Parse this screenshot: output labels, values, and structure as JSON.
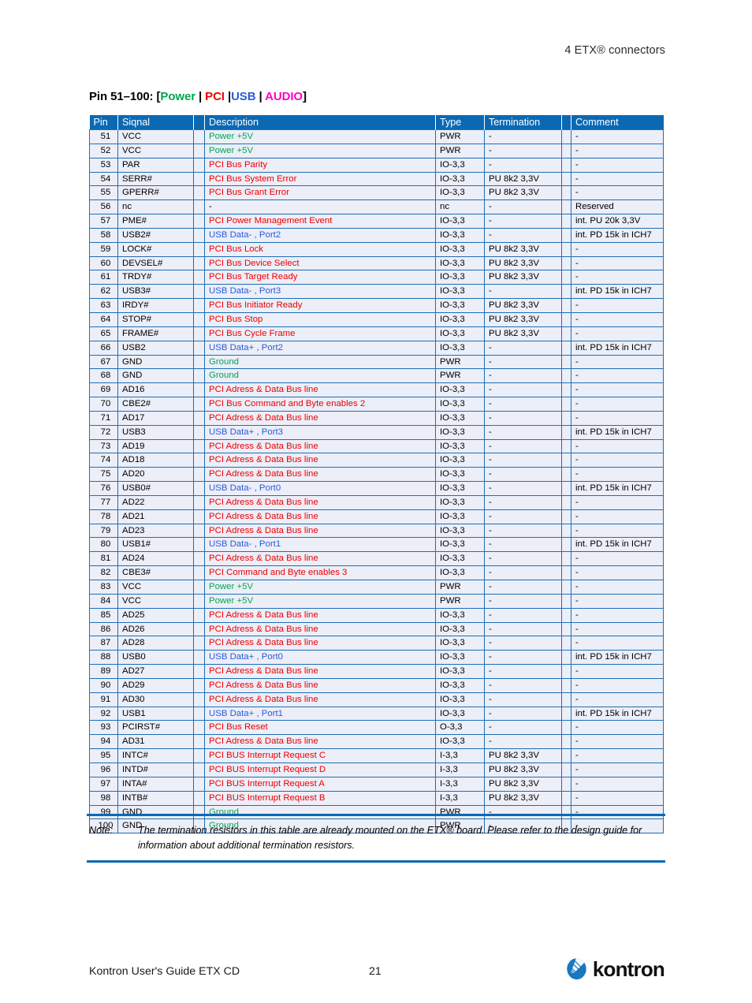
{
  "header": {
    "running_head": "4 ETX® connectors"
  },
  "section": {
    "title_prefix": "Pin 51–100: [",
    "legend": [
      {
        "label": "Power",
        "color": "#00a84f"
      },
      {
        "label": "PCI",
        "color": "#ee0000"
      },
      {
        "label": "USB",
        "color": "#2a5bd7"
      },
      {
        "label": "AUDIO",
        "color": "#ff00c8"
      }
    ],
    "title_suffix": "]",
    "separator": "|"
  },
  "table": {
    "columns": [
      "Pin",
      "Siqnal",
      "Description",
      "Type",
      "Termination",
      "Comment"
    ],
    "rows": [
      {
        "pin": "51",
        "signal": "VCC",
        "desc": "Power +5V",
        "desc_class": "power",
        "type": "PWR",
        "term": "-",
        "comment": "-"
      },
      {
        "pin": "52",
        "signal": "VCC",
        "desc": "Power +5V",
        "desc_class": "power",
        "type": "PWR",
        "term": "-",
        "comment": "-"
      },
      {
        "pin": "53",
        "signal": "PAR",
        "desc": "PCI Bus Parity",
        "desc_class": "pci",
        "type": "IO-3,3",
        "term": "-",
        "comment": "-"
      },
      {
        "pin": "54",
        "signal": "SERR#",
        "desc": "PCI Bus System Error",
        "desc_class": "pci",
        "type": "IO-3,3",
        "term": "PU 8k2 3,3V",
        "comment": "-"
      },
      {
        "pin": "55",
        "signal": "GPERR#",
        "desc": "PCI Bus Grant Error",
        "desc_class": "pci",
        "type": "IO-3,3",
        "term": "PU 8k2 3,3V",
        "comment": "-"
      },
      {
        "pin": "56",
        "signal": "nc",
        "desc": "-",
        "desc_class": "none",
        "type": "nc",
        "term": "-",
        "comment": "Reserved"
      },
      {
        "pin": "57",
        "signal": "PME#",
        "desc": "PCI Power Management Event",
        "desc_class": "pci",
        "type": "IO-3,3",
        "term": "-",
        "comment": "int. PU 20k 3,3V"
      },
      {
        "pin": "58",
        "signal": "USB2#",
        "desc": "USB Data- , Port2",
        "desc_class": "usb",
        "type": "IO-3,3",
        "term": "-",
        "comment": "int. PD 15k in ICH7"
      },
      {
        "pin": "59",
        "signal": "LOCK#",
        "desc": "PCI Bus Lock",
        "desc_class": "pci",
        "type": "IO-3,3",
        "term": "PU 8k2 3,3V",
        "comment": "-"
      },
      {
        "pin": "60",
        "signal": "DEVSEL#",
        "desc": "PCI Bus Device Select",
        "desc_class": "pci",
        "type": "IO-3,3",
        "term": "PU 8k2 3,3V",
        "comment": "-"
      },
      {
        "pin": "61",
        "signal": "TRDY#",
        "desc": "PCI Bus Target Ready",
        "desc_class": "pci",
        "type": "IO-3,3",
        "term": "PU 8k2 3,3V",
        "comment": "-"
      },
      {
        "pin": "62",
        "signal": "USB3#",
        "desc": "USB Data- , Port3",
        "desc_class": "usb",
        "type": "IO-3,3",
        "term": "-",
        "comment": "int. PD 15k in ICH7"
      },
      {
        "pin": "63",
        "signal": "IRDY#",
        "desc": "PCI Bus Initiator Ready",
        "desc_class": "pci",
        "type": "IO-3,3",
        "term": "PU 8k2 3,3V",
        "comment": "-"
      },
      {
        "pin": "64",
        "signal": "STOP#",
        "desc": "PCI Bus Stop",
        "desc_class": "pci",
        "type": "IO-3,3",
        "term": "PU 8k2 3,3V",
        "comment": "-"
      },
      {
        "pin": "65",
        "signal": "FRAME#",
        "desc": "PCI Bus Cycle Frame",
        "desc_class": "pci",
        "type": "IO-3,3",
        "term": "PU 8k2 3,3V",
        "comment": "-"
      },
      {
        "pin": "66",
        "signal": "USB2",
        "desc": "USB Data+ , Port2",
        "desc_class": "usb",
        "type": "IO-3,3",
        "term": "-",
        "comment": "int. PD 15k in ICH7"
      },
      {
        "pin": "67",
        "signal": "GND",
        "desc": "Ground",
        "desc_class": "power",
        "type": "PWR",
        "term": "-",
        "comment": "-"
      },
      {
        "pin": "68",
        "signal": "GND",
        "desc": "Ground",
        "desc_class": "power",
        "type": "PWR",
        "term": "-",
        "comment": "-"
      },
      {
        "pin": "69",
        "signal": "AD16",
        "desc": "PCI Adress & Data Bus line",
        "desc_class": "pci",
        "type": "IO-3,3",
        "term": "-",
        "comment": "-"
      },
      {
        "pin": "70",
        "signal": "CBE2#",
        "desc": "PCI Bus Command and Byte enables 2",
        "desc_class": "pci",
        "type": "IO-3,3",
        "term": "-",
        "comment": "-"
      },
      {
        "pin": "71",
        "signal": "AD17",
        "desc": "PCI Adress & Data Bus line",
        "desc_class": "pci",
        "type": "IO-3,3",
        "term": "-",
        "comment": "-"
      },
      {
        "pin": "72",
        "signal": "USB3",
        "desc": "USB Data+ , Port3",
        "desc_class": "usb",
        "type": "IO-3,3",
        "term": "-",
        "comment": "int. PD 15k in ICH7"
      },
      {
        "pin": "73",
        "signal": "AD19",
        "desc": "PCI Adress & Data Bus line",
        "desc_class": "pci",
        "type": "IO-3,3",
        "term": "-",
        "comment": "-"
      },
      {
        "pin": "74",
        "signal": "AD18",
        "desc": "PCI Adress & Data Bus line",
        "desc_class": "pci",
        "type": "IO-3,3",
        "term": "-",
        "comment": "-"
      },
      {
        "pin": "75",
        "signal": "AD20",
        "desc": "PCI Adress & Data Bus line",
        "desc_class": "pci",
        "type": "IO-3,3",
        "term": "-",
        "comment": "-"
      },
      {
        "pin": "76",
        "signal": "USB0#",
        "desc": "USB Data- , Port0",
        "desc_class": "usb",
        "type": "IO-3,3",
        "term": "-",
        "comment": "int. PD 15k in ICH7"
      },
      {
        "pin": "77",
        "signal": "AD22",
        "desc": "PCI Adress & Data Bus line",
        "desc_class": "pci",
        "type": "IO-3,3",
        "term": "-",
        "comment": "-"
      },
      {
        "pin": "78",
        "signal": "AD21",
        "desc": "PCI Adress & Data Bus line",
        "desc_class": "pci",
        "type": "IO-3,3",
        "term": "-",
        "comment": "-"
      },
      {
        "pin": "79",
        "signal": "AD23",
        "desc": "PCI Adress & Data Bus line",
        "desc_class": "pci",
        "type": "IO-3,3",
        "term": "-",
        "comment": "-"
      },
      {
        "pin": "80",
        "signal": "USB1#",
        "desc": "USB Data- , Port1",
        "desc_class": "usb",
        "type": "IO-3,3",
        "term": "-",
        "comment": "int. PD 15k in ICH7"
      },
      {
        "pin": "81",
        "signal": "AD24",
        "desc": "PCI Adress & Data Bus line",
        "desc_class": "pci",
        "type": "IO-3,3",
        "term": "-",
        "comment": "-"
      },
      {
        "pin": "82",
        "signal": "CBE3#",
        "desc": "PCI Command and Byte enables 3",
        "desc_class": "pci",
        "type": "IO-3,3",
        "term": "-",
        "comment": "-"
      },
      {
        "pin": "83",
        "signal": "VCC",
        "desc": "Power +5V",
        "desc_class": "power",
        "type": "PWR",
        "term": "-",
        "comment": "-"
      },
      {
        "pin": "84",
        "signal": "VCC",
        "desc": "Power +5V",
        "desc_class": "power",
        "type": "PWR",
        "term": "-",
        "comment": "-"
      },
      {
        "pin": "85",
        "signal": "AD25",
        "desc": "PCI Adress & Data Bus line",
        "desc_class": "pci",
        "type": "IO-3,3",
        "term": "-",
        "comment": "-"
      },
      {
        "pin": "86",
        "signal": "AD26",
        "desc": "PCI Adress & Data Bus line",
        "desc_class": "pci",
        "type": "IO-3,3",
        "term": "-",
        "comment": "-"
      },
      {
        "pin": "87",
        "signal": "AD28",
        "desc": "PCI Adress & Data Bus line",
        "desc_class": "pci",
        "type": "IO-3,3",
        "term": "-",
        "comment": "-"
      },
      {
        "pin": "88",
        "signal": "USB0",
        "desc": "USB Data+ , Port0",
        "desc_class": "usb",
        "type": "IO-3,3",
        "term": "-",
        "comment": "int. PD 15k in ICH7"
      },
      {
        "pin": "89",
        "signal": "AD27",
        "desc": "PCI Adress & Data Bus line",
        "desc_class": "pci",
        "type": "IO-3,3",
        "term": "-",
        "comment": "-"
      },
      {
        "pin": "90",
        "signal": "AD29",
        "desc": "PCI Adress & Data Bus line",
        "desc_class": "pci",
        "type": "IO-3,3",
        "term": "-",
        "comment": "-"
      },
      {
        "pin": "91",
        "signal": "AD30",
        "desc": "PCI Adress & Data Bus line",
        "desc_class": "pci",
        "type": "IO-3,3",
        "term": "-",
        "comment": "-"
      },
      {
        "pin": "92",
        "signal": "USB1",
        "desc": "USB Data+ , Port1",
        "desc_class": "usb",
        "type": "IO-3,3",
        "term": "-",
        "comment": "int. PD 15k in ICH7"
      },
      {
        "pin": "93",
        "signal": "PCIRST#",
        "desc": "PCI Bus Reset",
        "desc_class": "pci",
        "type": "O-3,3",
        "term": "-",
        "comment": "-"
      },
      {
        "pin": "94",
        "signal": "AD31",
        "desc": "PCI Adress & Data Bus line",
        "desc_class": "pci",
        "type": "IO-3,3",
        "term": "-",
        "comment": "-"
      },
      {
        "pin": "95",
        "signal": "INTC#",
        "desc": "PCI BUS Interrupt Request C",
        "desc_class": "pci",
        "type": "I-3,3",
        "term": "PU 8k2 3,3V",
        "comment": "-"
      },
      {
        "pin": "96",
        "signal": "INTD#",
        "desc": "PCI BUS Interrupt Request D",
        "desc_class": "pci",
        "type": "I-3,3",
        "term": "PU 8k2 3,3V",
        "comment": "-"
      },
      {
        "pin": "97",
        "signal": "INTA#",
        "desc": "PCI BUS Interrupt Request A",
        "desc_class": "pci",
        "type": "I-3,3",
        "term": "PU 8k2 3,3V",
        "comment": "-"
      },
      {
        "pin": "98",
        "signal": "INTB#",
        "desc": "PCI BUS Interrupt Request B",
        "desc_class": "pci",
        "type": "I-3,3",
        "term": "PU 8k2 3,3V",
        "comment": "-"
      },
      {
        "pin": "99",
        "signal": "GND",
        "desc": "Ground",
        "desc_class": "power",
        "type": "PWR",
        "term": "-",
        "comment": "-"
      },
      {
        "pin": "100",
        "signal": "GND",
        "desc": "Ground",
        "desc_class": "power",
        "type": "PWR",
        "term": "-",
        "comment": "-"
      }
    ]
  },
  "note": {
    "label": "Note:",
    "text": "The termination resistors in this table are already mounted on the ETX® board. Please refer to the design guide for information about additional termination resistors."
  },
  "footer": {
    "document": "Kontron User's Guide ETX CD",
    "page_number": "21",
    "logo_text": "kontron",
    "logo_icon": "kontron-globe-icon"
  },
  "colors": {
    "table_header_bg": "#0b69b4",
    "table_row_bg": "#eceef8",
    "rule": "#0b69b4",
    "power": "#00a84f",
    "pci": "#ee0000",
    "usb": "#2a5bd7",
    "audio": "#ff00c8"
  }
}
